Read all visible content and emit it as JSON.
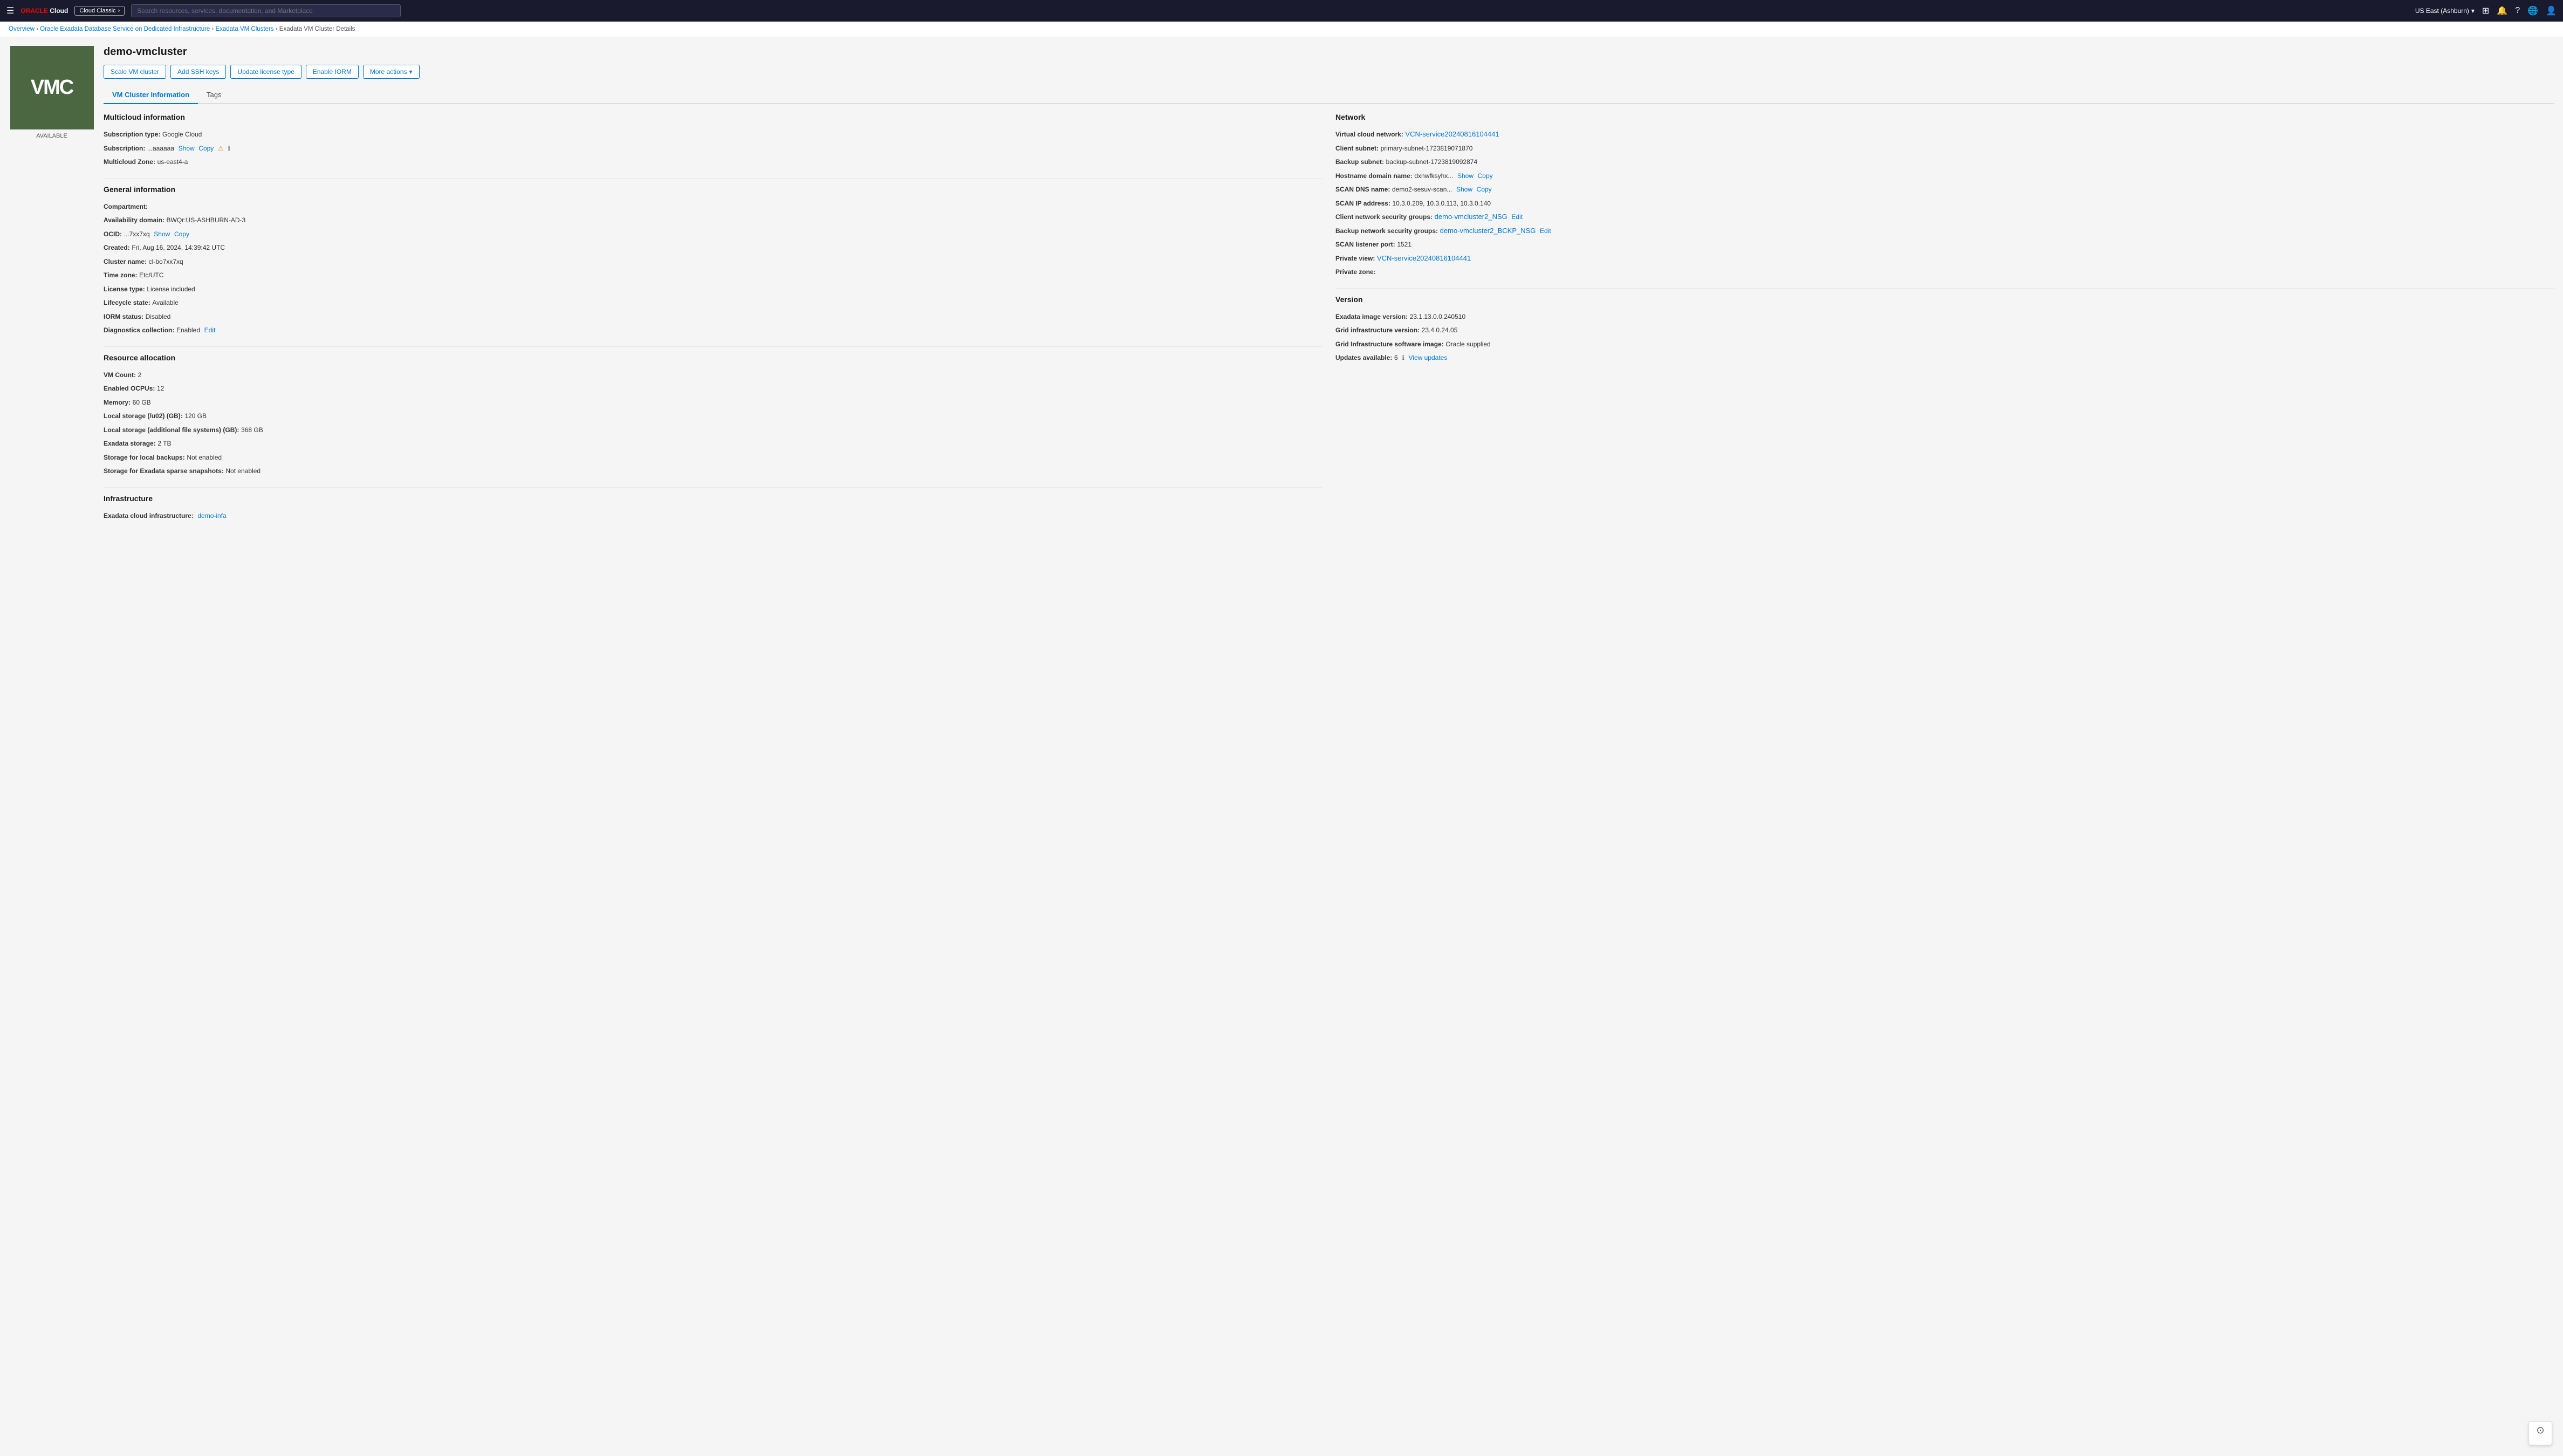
{
  "topnav": {
    "logo": "ORACLE Cloud",
    "cloud_classic_label": "Cloud Classic",
    "search_placeholder": "Search resources, services, documentation, and Marketplace",
    "region": "US East (Ashburn)",
    "icons": [
      "grid-icon",
      "bell-icon",
      "help-icon",
      "globe-icon",
      "profile-icon"
    ]
  },
  "breadcrumb": {
    "items": [
      {
        "label": "Overview",
        "href": "#"
      },
      {
        "label": "Oracle Exadata Database Service on Dedicated Infrastructure",
        "href": "#"
      },
      {
        "label": "Exadata VM Clusters",
        "href": "#"
      },
      {
        "label": "Exadata VM Cluster Details",
        "href": null
      }
    ]
  },
  "page": {
    "title": "demo-vmcluster",
    "logo_text": "VMC",
    "status": "AVAILABLE"
  },
  "toolbar": {
    "buttons": [
      {
        "label": "Scale VM cluster",
        "id": "scale-vm-cluster"
      },
      {
        "label": "Add SSH keys",
        "id": "add-ssh-keys"
      },
      {
        "label": "Update license type",
        "id": "update-license-type"
      },
      {
        "label": "Enable IORM",
        "id": "enable-iorm"
      },
      {
        "label": "More actions",
        "id": "more-actions",
        "dropdown": true
      }
    ]
  },
  "tabs": [
    {
      "label": "VM Cluster Information",
      "active": true
    },
    {
      "label": "Tags",
      "active": false
    }
  ],
  "multicloud": {
    "title": "Multicloud information",
    "fields": [
      {
        "label": "Subscription type:",
        "value": "Google Cloud"
      },
      {
        "label": "Subscription:",
        "value": "...aaaaaa",
        "show": true,
        "copy": true,
        "warning": true,
        "info": true
      },
      {
        "label": "Multicloud Zone:",
        "value": "us-east4-a"
      }
    ]
  },
  "general": {
    "title": "General information",
    "fields": [
      {
        "label": "Compartment:",
        "value": ""
      },
      {
        "label": "Availability domain:",
        "value": "BWQr:US-ASHBURN-AD-3"
      },
      {
        "label": "OCID:",
        "value": "...7xx7xq",
        "show": true,
        "copy": true
      },
      {
        "label": "Created:",
        "value": "Fri, Aug 16, 2024, 14:39:42 UTC"
      },
      {
        "label": "Cluster name:",
        "value": "cl-bo7xx7xq"
      },
      {
        "label": "Time zone:",
        "value": "Etc/UTC"
      },
      {
        "label": "License type:",
        "value": "License included"
      },
      {
        "label": "Lifecycle state:",
        "value": "Available"
      },
      {
        "label": "IORM status:",
        "value": "Disabled"
      },
      {
        "label": "Diagnostics collection:",
        "value": "Enabled",
        "edit": true
      }
    ]
  },
  "resource_allocation": {
    "title": "Resource allocation",
    "fields": [
      {
        "label": "VM Count:",
        "value": "2"
      },
      {
        "label": "Enabled OCPUs:",
        "value": "12"
      },
      {
        "label": "Memory:",
        "value": "60 GB"
      },
      {
        "label": "Local storage (/u02) (GB):",
        "value": "120 GB"
      },
      {
        "label": "Local storage (additional file systems) (GB):",
        "value": "368 GB"
      },
      {
        "label": "Exadata storage:",
        "value": "2 TB"
      },
      {
        "label": "Storage for local backups:",
        "value": "Not enabled"
      },
      {
        "label": "Storage for Exadata sparse snapshots:",
        "value": "Not enabled"
      }
    ]
  },
  "infrastructure": {
    "title": "Infrastructure",
    "fields": [
      {
        "label": "Exadata cloud infrastructure:",
        "value": "demo-infa",
        "link": true
      }
    ]
  },
  "network": {
    "title": "Network",
    "fields": [
      {
        "label": "Virtual cloud network:",
        "value": "VCN-service20240816104441",
        "link": true
      },
      {
        "label": "Client subnet:",
        "value": "primary-subnet-1723819071870"
      },
      {
        "label": "Backup subnet:",
        "value": "backup-subnet-1723819092874"
      },
      {
        "label": "Hostname domain name:",
        "value": "dxnwfksyhx...",
        "show": true,
        "copy": true
      },
      {
        "label": "SCAN DNS name:",
        "value": "demo2-sesuv-scan...",
        "show": true,
        "copy": true
      },
      {
        "label": "SCAN IP address:",
        "value": "10.3.0.209, 10.3.0.113, 10.3.0.140"
      },
      {
        "label": "Client network security groups:",
        "value": "demo-vmcluster2_NSG",
        "link": true,
        "edit": true
      },
      {
        "label": "Backup network security groups:",
        "value": "demo-vmcluster2_BCKP_NSG",
        "link": true,
        "edit": true
      },
      {
        "label": "SCAN listener port:",
        "value": "1521"
      },
      {
        "label": "Private view:",
        "value": "VCN-service20240816104441",
        "link": true
      },
      {
        "label": "Private zone:",
        "value": ""
      }
    ]
  },
  "version": {
    "title": "Version",
    "fields": [
      {
        "label": "Exadata image version:",
        "value": "23.1.13.0.0.240510"
      },
      {
        "label": "Grid infrastructure version:",
        "value": "23.4.0.24.05"
      },
      {
        "label": "Grid Infrastructure software image:",
        "value": "Oracle supplied"
      },
      {
        "label": "Updates available:",
        "value": "6",
        "info": true,
        "view_updates": true
      }
    ]
  }
}
